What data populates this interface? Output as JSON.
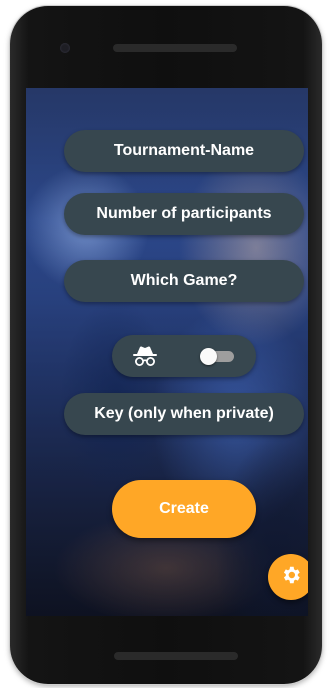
{
  "form": {
    "tournament_name_placeholder": "Tournament-Name",
    "participants_placeholder": "Number of participants",
    "game_placeholder": "Which Game?",
    "key_placeholder": "Key (only when private)"
  },
  "privacy": {
    "icon": "incognito-icon",
    "switch_on": false
  },
  "actions": {
    "create_label": "Create",
    "settings_icon": "gear-icon"
  },
  "colors": {
    "field_bg": "#37474f",
    "accent": "#ffa726",
    "text": "#ffffff"
  }
}
